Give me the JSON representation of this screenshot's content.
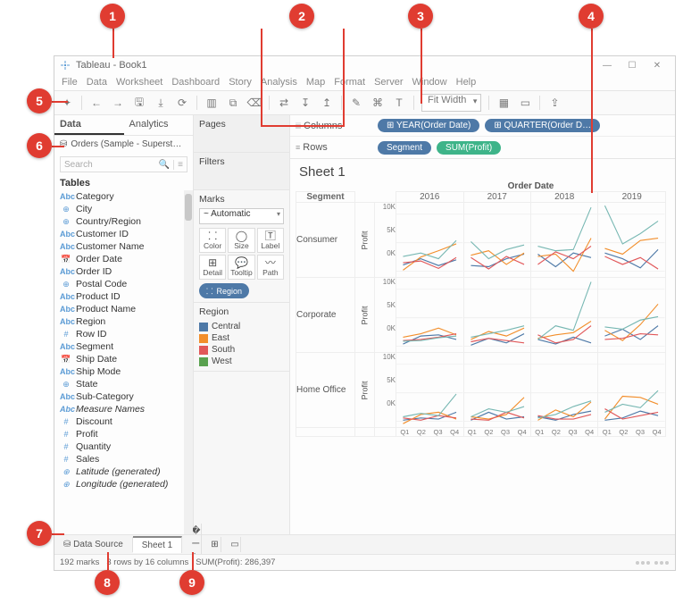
{
  "callouts": [
    "1",
    "2",
    "3",
    "4",
    "5",
    "6",
    "7",
    "8",
    "9"
  ],
  "window": {
    "app": "Tableau",
    "doc": "Book1"
  },
  "menu": [
    "File",
    "Data",
    "Worksheet",
    "Dashboard",
    "Story",
    "Analysis",
    "Map",
    "Format",
    "Server",
    "Window",
    "Help"
  ],
  "toolbar": {
    "fit": "Fit Width"
  },
  "shelves": {
    "columns_label": "Columns",
    "rows_label": "Rows",
    "columns": [
      "YEAR(Order Date)",
      "QUARTER(Order D…"
    ],
    "rows_dim": "Segment",
    "rows_meas": "SUM(Profit)"
  },
  "side": {
    "tab_data": "Data",
    "tab_analytics": "Analytics",
    "datasource": "Orders (Sample - Superst…",
    "search": "Search",
    "tables": "Tables"
  },
  "fields": [
    {
      "t": "abc",
      "n": "Category"
    },
    {
      "t": "geo",
      "n": "City"
    },
    {
      "t": "geo",
      "n": "Country/Region"
    },
    {
      "t": "abc",
      "n": "Customer ID"
    },
    {
      "t": "abc",
      "n": "Customer Name"
    },
    {
      "t": "date",
      "n": "Order Date"
    },
    {
      "t": "abc",
      "n": "Order ID"
    },
    {
      "t": "geo",
      "n": "Postal Code"
    },
    {
      "t": "abc",
      "n": "Product ID"
    },
    {
      "t": "abc",
      "n": "Product Name"
    },
    {
      "t": "abc",
      "n": "Region"
    },
    {
      "t": "num",
      "n": "Row ID"
    },
    {
      "t": "abc",
      "n": "Segment"
    },
    {
      "t": "date",
      "n": "Ship Date"
    },
    {
      "t": "abc",
      "n": "Ship Mode"
    },
    {
      "t": "geo",
      "n": "State"
    },
    {
      "t": "abc",
      "n": "Sub-Category"
    },
    {
      "t": "abc",
      "n": "Measure Names",
      "i": true
    },
    {
      "t": "num",
      "n": "Discount"
    },
    {
      "t": "num",
      "n": "Profit"
    },
    {
      "t": "num",
      "n": "Quantity"
    },
    {
      "t": "num",
      "n": "Sales"
    },
    {
      "t": "geo",
      "n": "Latitude (generated)",
      "i": true
    },
    {
      "t": "geo",
      "n": "Longitude (generated)",
      "i": true
    }
  ],
  "cards": {
    "pages": "Pages",
    "filters": "Filters",
    "marks": "Marks",
    "mark_type": "Automatic",
    "btns": [
      "Color",
      "Size",
      "Label",
      "Detail",
      "Tooltip",
      "Path"
    ],
    "pill": "Region",
    "legend_title": "Region"
  },
  "legend": [
    {
      "name": "Central",
      "color": "#4e79a7"
    },
    {
      "name": "East",
      "color": "#f28e2b"
    },
    {
      "name": "South",
      "color": "#e15759"
    },
    {
      "name": "West",
      "color": "#59a14f"
    }
  ],
  "viz": {
    "title": "Sheet 1",
    "super_header": "Order Date",
    "segment_label": "Segment",
    "profit_label": "Profit"
  },
  "tabs": {
    "data_source": "Data Source",
    "sheet1": "Sheet 1"
  },
  "status": {
    "marks": "192 marks",
    "shape": "3 rows by 16 columns",
    "sum": "SUM(Profit): 286,397"
  },
  "chart_data": {
    "type": "line",
    "rows": [
      "Consumer",
      "Corporate",
      "Home Office"
    ],
    "cols": [
      "2016",
      "2017",
      "2018",
      "2019"
    ],
    "x": [
      "Q1",
      "Q2",
      "Q3",
      "Q4"
    ],
    "ylabel": "Profit",
    "yticks": [
      0,
      5,
      10
    ],
    "ytick_labels": [
      "0K",
      "5K",
      "10K"
    ],
    "ylim": [
      -1,
      12
    ],
    "series_colors": {
      "Central": "#4e79a7",
      "East": "#f28e2b",
      "South": "#e15759",
      "West": "#76b7b2"
    },
    "data": {
      "Consumer": {
        "2016": {
          "Central": [
            1.1,
            2.2,
            1.0,
            2.0
          ],
          "East": [
            0.2,
            2.5,
            3.6,
            4.8
          ],
          "South": [
            1.5,
            1.8,
            0.5,
            2.4
          ],
          "West": [
            2.6,
            3.2,
            2.2,
            5.4
          ]
        },
        "2017": {
          "Central": [
            1.0,
            0.8,
            2.2,
            3.0
          ],
          "East": [
            2.8,
            3.6,
            1.2,
            3.2
          ],
          "South": [
            2.4,
            0.4,
            2.6,
            1.2
          ],
          "West": [
            5.2,
            2.2,
            3.8,
            4.6
          ]
        },
        "2018": {
          "Central": [
            3.0,
            0.8,
            3.2,
            2.4
          ],
          "East": [
            2.6,
            3.0,
            0.0,
            5.8
          ],
          "South": [
            1.2,
            3.4,
            2.2,
            4.4
          ],
          "West": [
            4.4,
            3.6,
            3.8,
            11.2
          ]
        },
        "2019": {
          "Central": [
            3.2,
            2.2,
            0.6,
            3.8
          ],
          "East": [
            4.0,
            3.0,
            5.4,
            5.8
          ],
          "South": [
            2.6,
            1.2,
            2.4,
            0.4
          ],
          "West": [
            11.5,
            4.8,
            6.6,
            8.8
          ]
        }
      },
      "Corporate": {
        "2016": {
          "Central": [
            0.4,
            1.8,
            2.0,
            1.2
          ],
          "East": [
            1.6,
            2.2,
            3.2,
            2.0
          ],
          "South": [
            1.0,
            1.2,
            1.6,
            2.2
          ],
          "West": [
            0.9,
            1.0,
            1.5,
            1.8
          ]
        },
        "2017": {
          "Central": [
            0.2,
            1.4,
            0.6,
            2.2
          ],
          "East": [
            1.2,
            2.6,
            1.8,
            3.2
          ],
          "South": [
            0.8,
            1.4,
            1.0,
            0.6
          ],
          "West": [
            1.6,
            2.2,
            2.8,
            3.6
          ]
        },
        "2018": {
          "Central": [
            1.2,
            0.4,
            1.6,
            0.6
          ],
          "East": [
            1.4,
            2.0,
            2.4,
            4.4
          ],
          "South": [
            2.0,
            0.6,
            1.2,
            3.6
          ],
          "West": [
            1.2,
            3.6,
            2.8,
            11.3
          ]
        },
        "2019": {
          "Central": [
            1.8,
            3.0,
            1.2,
            3.6
          ],
          "East": [
            2.8,
            1.0,
            3.8,
            7.4
          ],
          "South": [
            1.2,
            1.4,
            2.2,
            2.0
          ],
          "West": [
            3.4,
            3.0,
            4.6,
            5.2
          ]
        }
      },
      "Home Office": {
        "2016": {
          "Central": [
            0.2,
            0.6,
            0.4,
            1.6
          ],
          "East": [
            -0.4,
            1.2,
            1.6,
            0.4
          ],
          "South": [
            0.6,
            0.2,
            1.0,
            0.6
          ],
          "West": [
            0.8,
            1.4,
            1.0,
            4.8
          ]
        },
        "2017": {
          "Central": [
            0.2,
            1.6,
            0.4,
            0.8
          ],
          "East": [
            0.8,
            0.4,
            1.2,
            4.2
          ],
          "South": [
            0.4,
            0.2,
            1.6,
            0.6
          ],
          "West": [
            0.8,
            2.2,
            1.6,
            2.6
          ]
        },
        "2018": {
          "Central": [
            0.8,
            0.2,
            1.2,
            1.8
          ],
          "East": [
            0.2,
            2.0,
            0.8,
            3.4
          ],
          "South": [
            1.0,
            0.4,
            0.4,
            1.2
          ],
          "West": [
            0.6,
            1.2,
            2.6,
            3.6
          ]
        },
        "2019": {
          "Central": [
            0.2,
            0.6,
            1.8,
            1.0
          ],
          "East": [
            0.4,
            4.4,
            4.2,
            3.0
          ],
          "South": [
            2.2,
            0.4,
            1.0,
            1.6
          ],
          "West": [
            1.6,
            3.0,
            2.4,
            5.4
          ]
        }
      }
    }
  }
}
